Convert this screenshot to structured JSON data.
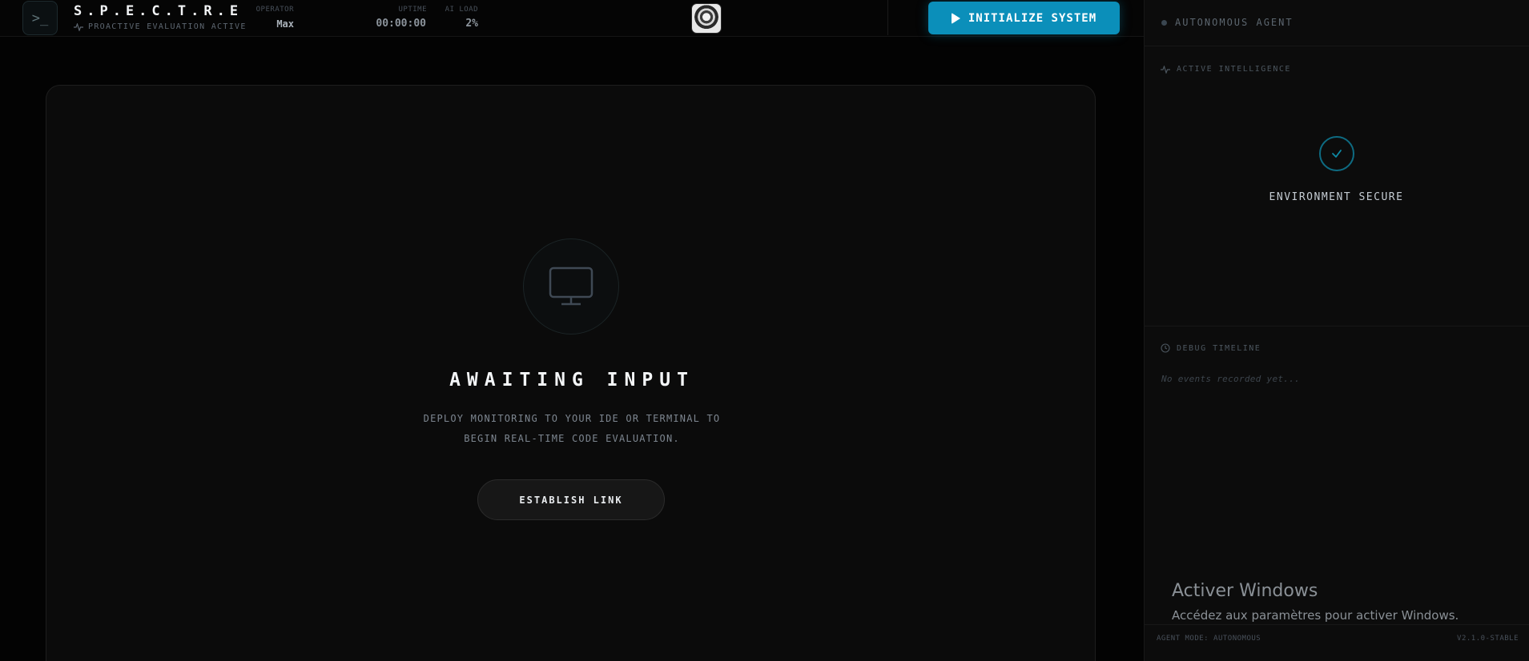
{
  "header": {
    "logo_glyph": ">_",
    "title": "S.P.E.C.T.R.E",
    "subtitle": "PROACTIVE EVALUATION ACTIVE",
    "operator_label": "OPERATOR",
    "operator_name": "Max",
    "uptime_label": "UPTIME",
    "uptime_value": "00:00:00",
    "load_label": "AI LOAD",
    "load_value": "2%",
    "init_button_label": "INITIALIZE SYSTEM"
  },
  "main": {
    "title": "AWAITING INPUT",
    "description_line1": "DEPLOY MONITORING TO YOUR IDE OR TERMINAL TO",
    "description_line2": "BEGIN REAL-TIME CODE EVALUATION.",
    "link_button_label": "ESTABLISH LINK"
  },
  "panel": {
    "title": "AUTONOMOUS AGENT",
    "active_intel_label": "ACTIVE INTELLIGENCE",
    "status_text": "ENVIRONMENT SECURE",
    "debug_label": "DEBUG TIMELINE",
    "empty_events": "No events recorded yet...",
    "footer_mode": "AGENT MODE: AUTONOMOUS",
    "footer_version": "V2.1.0-STABLE"
  },
  "watermark": {
    "title": "Activer Windows",
    "subtitle": "Accédez aux paramètres pour activer Windows."
  },
  "colors": {
    "accent": "#0b8fba",
    "background": "#030303",
    "card": "#0b0b0b",
    "panel": "#0c0c0c"
  },
  "icons": [
    "terminal-icon",
    "activity-icon",
    "play-icon",
    "monitor-icon",
    "check-icon",
    "clock-icon"
  ]
}
